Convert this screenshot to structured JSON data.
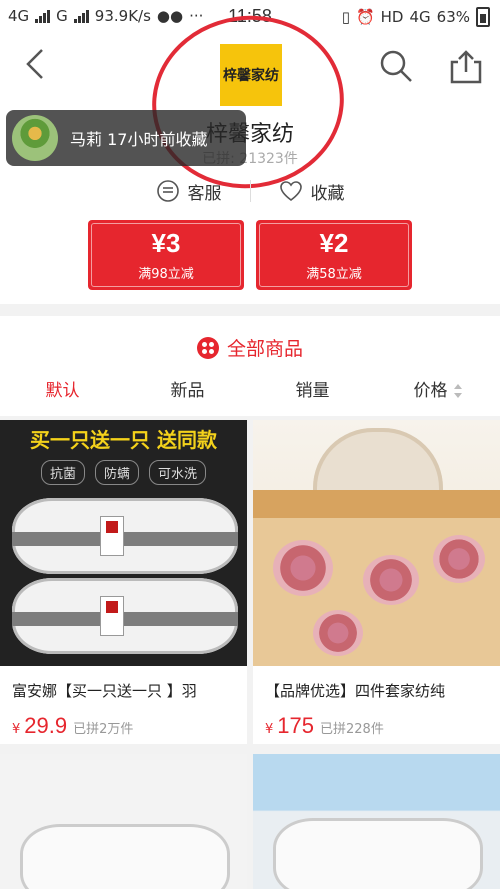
{
  "status_bar": {
    "left": [
      "4G",
      "G",
      "93.9K/s"
    ],
    "time": "11:58",
    "right": [
      "HD",
      "4G",
      "63%"
    ]
  },
  "header": {
    "logo_text": "梓馨家纺",
    "shop_name": "梓馨家纺",
    "sold_text": "已拼: 21323件",
    "toast": "马莉 17小时前收藏",
    "service_label": "客服",
    "favorite_label": "收藏"
  },
  "coupons": [
    {
      "amount": "¥3",
      "condition": "满98立减"
    },
    {
      "amount": "¥2",
      "condition": "满58立减"
    }
  ],
  "all_products": {
    "title": "全部商品",
    "sort_tabs": [
      "默认",
      "新品",
      "销量",
      "价格"
    ]
  },
  "products": [
    {
      "banner": "买一只送一只 送同款",
      "badges": [
        "抗菌",
        "防螨",
        "可水洗"
      ],
      "title": "富安娜【买一只送一只 】羽",
      "currency": "¥",
      "price": "29.9",
      "sold": "已拼2万件"
    },
    {
      "title": "【品牌优选】四件套家纺纯",
      "currency": "¥",
      "price": "175",
      "sold": "已拼228件"
    }
  ],
  "colors": {
    "accent": "#e6262e",
    "logo_bg": "#f6c40c"
  }
}
